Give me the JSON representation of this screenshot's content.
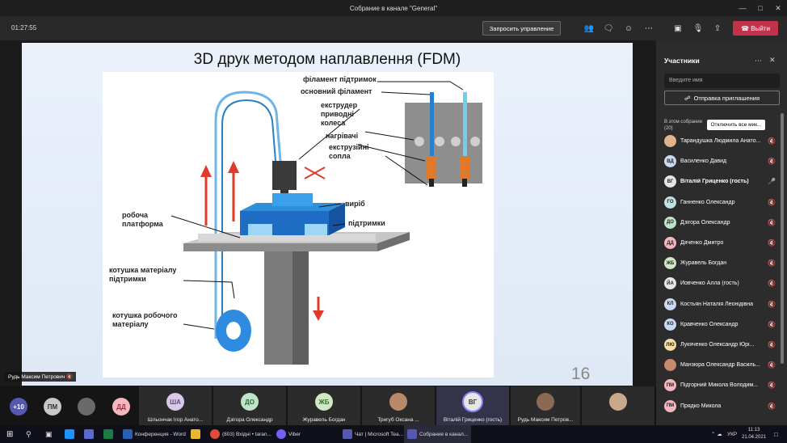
{
  "window": {
    "title": "Собрание в канале \"General\""
  },
  "toolbar": {
    "timer": "01:27:55",
    "request_control": "Запросить управление",
    "leave": "Выйти"
  },
  "slide": {
    "title": "3D друк методом наплавлення (FDM)",
    "page_number": "16",
    "labels": {
      "support_filament": "філамент підтримок",
      "main_filament": "основний філамент",
      "drive_wheels": "екструдер\nприводні\nколеса",
      "heaters": "нагрівачі",
      "nozzles": "екструзійні\nсопла",
      "product": "виріб",
      "supports": "підтримки",
      "platform": "робоча\nплатформа",
      "support_spool": "котушка матеріалу\nпідтримки",
      "main_spool": "котушка робочого\nматеріалу"
    }
  },
  "presenter": "Рудь Максим Петрович",
  "strip": {
    "overflow": "+10",
    "avatars": [
      {
        "initials": "ПМ",
        "color": "#c8c8c8"
      },
      {
        "initials": "ДД",
        "color": "#f4b7c0"
      }
    ],
    "tiles": [
      {
        "initials": "ША",
        "name": "Шльончак Ігор Анато...",
        "color": "#d9c8e8"
      },
      {
        "initials": "ДО",
        "name": "Дзігора Олександр",
        "color": "#bfe3c8"
      },
      {
        "initials": "ЖБ",
        "name": "Журавель Богдан",
        "color": "#cfe8c5"
      },
      {
        "initials": "",
        "name": "Тригуб Оксана ...",
        "color": "#b98a6a"
      },
      {
        "initials": "ВГ",
        "name": "Віталій Гриценко (гость)",
        "color": "#e6e6e6"
      },
      {
        "initials": "",
        "name": "Рудь Максим Петров...",
        "color": "#8a6a55"
      },
      {
        "initials": "",
        "name": "",
        "color": "#c9a98a"
      }
    ]
  },
  "panel": {
    "title": "Участники",
    "search_placeholder": "Введите имя",
    "invite": "Отправка приглашения",
    "in_meeting": "В этом собрании\n(20)",
    "mute_all": "Отключить все мик...",
    "participants": [
      {
        "initials": "",
        "name": "Тарандушка Людмила Анато...",
        "color": "#e0b48a"
      },
      {
        "initials": "ВД",
        "name": "Василенко Давид",
        "color": "#c7daf5"
      },
      {
        "initials": "ВГ",
        "name": "Віталій Гриценко (гость)",
        "color": "#e6e6e6"
      },
      {
        "initials": "ГО",
        "name": "Ганненко Олександр",
        "color": "#bfe3e3"
      },
      {
        "initials": "ДО",
        "name": "Дзігора Олександр",
        "color": "#bfe3c8"
      },
      {
        "initials": "ДД",
        "name": "Дяченко Дмитро",
        "color": "#f4b7c0"
      },
      {
        "initials": "ЖБ",
        "name": "Журавель Богдан",
        "color": "#cfe8c5"
      },
      {
        "initials": "ЙА",
        "name": "Йовченко Алла (гость)",
        "color": "#e6e6e6"
      },
      {
        "initials": "КЛ",
        "name": "Костьян Наталія Леонідівна",
        "color": "#c7daf5"
      },
      {
        "initials": "КО",
        "name": "Кравченко Олександр",
        "color": "#c7daf5"
      },
      {
        "initials": "ЛЮ",
        "name": "Лукяченко Олександр Юрі...",
        "color": "#f6dfa8"
      },
      {
        "initials": "",
        "name": "Манзюра Олександр Василь...",
        "color": "#c58a70"
      },
      {
        "initials": "ПМ",
        "name": "Підгорний Микола Володим...",
        "color": "#f4b7c0"
      },
      {
        "initials": "ПМ",
        "name": "Прядко Микола",
        "color": "#f4b7c0"
      }
    ]
  },
  "taskbar": {
    "items": [
      "Конференция - Word",
      "(803) Вхідні • taran...",
      "Viber",
      "Чат | Microsoft Tea...",
      "Собрание в канал..."
    ],
    "lang": "УКР",
    "time": "11:13",
    "date": "21.04.2021"
  }
}
